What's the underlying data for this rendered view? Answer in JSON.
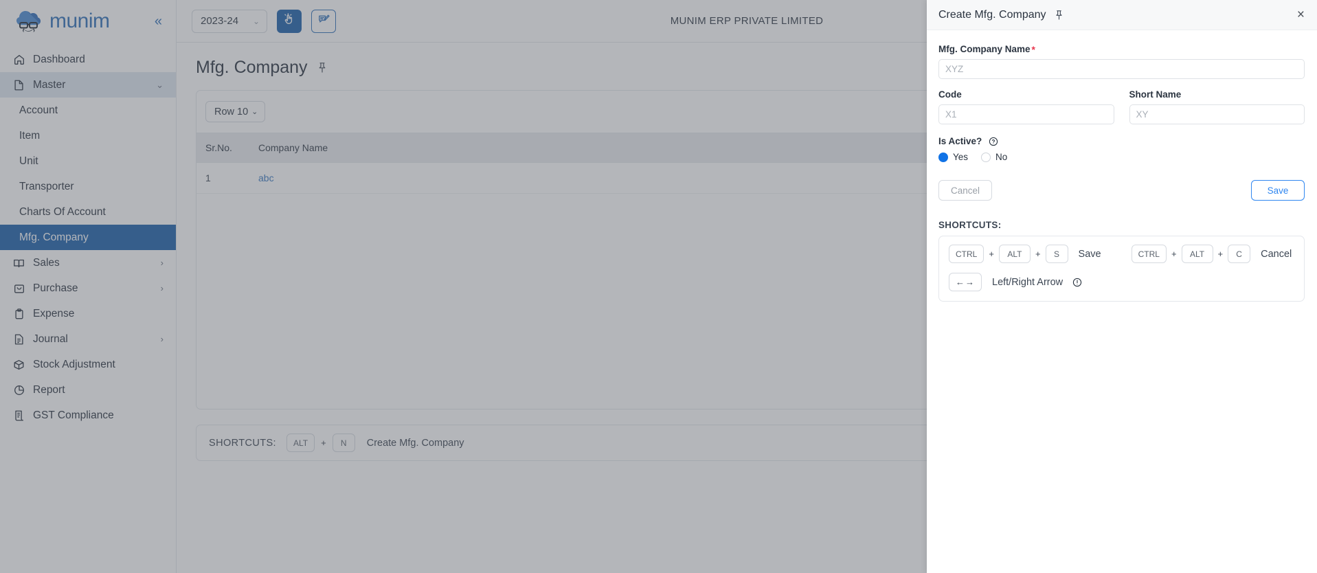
{
  "sidebar": {
    "brand": "munim",
    "collapse_label": "«",
    "items": [
      {
        "label": "Dashboard",
        "icon": "home-icon",
        "state": "normal",
        "level": "top",
        "chevron": ""
      },
      {
        "label": "Master",
        "icon": "file-icon",
        "state": "expanded",
        "level": "top",
        "chevron": "⌄"
      },
      {
        "label": "Account",
        "icon": "",
        "state": "normal",
        "level": "sub",
        "chevron": ""
      },
      {
        "label": "Item",
        "icon": "",
        "state": "normal",
        "level": "sub",
        "chevron": ""
      },
      {
        "label": "Unit",
        "icon": "",
        "state": "normal",
        "level": "sub",
        "chevron": ""
      },
      {
        "label": "Transporter",
        "icon": "",
        "state": "normal",
        "level": "sub",
        "chevron": ""
      },
      {
        "label": "Charts Of Account",
        "icon": "",
        "state": "normal",
        "level": "sub",
        "chevron": ""
      },
      {
        "label": "Mfg. Company",
        "icon": "",
        "state": "active",
        "level": "sub",
        "chevron": ""
      },
      {
        "label": "Sales",
        "icon": "book-icon",
        "state": "normal",
        "level": "top",
        "chevron": "›"
      },
      {
        "label": "Purchase",
        "icon": "bag-icon",
        "state": "normal",
        "level": "top",
        "chevron": "›"
      },
      {
        "label": "Expense",
        "icon": "clipboard-icon",
        "state": "normal",
        "level": "top",
        "chevron": ""
      },
      {
        "label": "Journal",
        "icon": "journal-icon",
        "state": "normal",
        "level": "top",
        "chevron": "›"
      },
      {
        "label": "Stock Adjustment",
        "icon": "box-icon",
        "state": "normal",
        "level": "top",
        "chevron": ""
      },
      {
        "label": "Report",
        "icon": "pie-icon",
        "state": "normal",
        "level": "top",
        "chevron": ""
      },
      {
        "label": "GST Compliance",
        "icon": "scroll-icon",
        "state": "normal",
        "level": "top",
        "chevron": ""
      }
    ]
  },
  "topbar": {
    "year": "2023-24",
    "year_caret": "⌄",
    "pointer_button_icon": "click-pointer-icon",
    "feedback_button_icon": "feedback-edit-icon",
    "company": "MUNIM ERP PRIVATE LIMITED",
    "company_caret": "⌄"
  },
  "page": {
    "title": "Mfg. Company",
    "pin_icon": "pin-icon"
  },
  "table": {
    "row_select_label": "Row 10",
    "row_select_caret": "⌄",
    "columns": [
      "Sr.No.",
      "Company Name"
    ],
    "rows": [
      {
        "sr": "1",
        "name": "abc"
      }
    ]
  },
  "page_shortcuts": {
    "label": "SHORTCUTS:",
    "keys": [
      "ALT",
      "N"
    ],
    "plus": "+",
    "action": "Create Mfg. Company"
  },
  "drawer": {
    "title": "Create Mfg. Company",
    "pin_icon": "pin-icon",
    "close_icon": "×",
    "fields": {
      "company_name": {
        "label": "Mfg. Company Name",
        "required_mark": "*",
        "value": "",
        "placeholder": "XYZ"
      },
      "code": {
        "label": "Code",
        "value": "",
        "placeholder": "X1"
      },
      "short_name": {
        "label": "Short Name",
        "value": "",
        "placeholder": "XY"
      }
    },
    "is_active": {
      "label": "Is Active?",
      "help_icon": "question-circle-icon",
      "options": [
        {
          "label": "Yes",
          "selected": true
        },
        {
          "label": "No",
          "selected": false
        }
      ]
    },
    "buttons": {
      "cancel": "Cancel",
      "save": "Save"
    },
    "shortcuts": {
      "title": "SHORTCUTS:",
      "plus": "+",
      "rows": [
        {
          "keys": [
            "CTRL",
            "ALT",
            "S"
          ],
          "action": "Save"
        },
        {
          "keys": [
            "CTRL",
            "ALT",
            "C"
          ],
          "action": "Cancel"
        }
      ],
      "arrow_key": "←→",
      "arrow_action": "Left/Right Arrow",
      "info_icon": "exclamation-circle-icon"
    }
  },
  "colors": {
    "brand_blue": "#2f6fb8",
    "active_nav": "#1b5faa",
    "expanded_nav": "#dfe7f1",
    "link_blue": "#3a79c0",
    "radio_blue": "#1173e6",
    "save_blue": "#2f86f0",
    "required_red": "#e8384f",
    "header_grey": "#e9ecef"
  }
}
